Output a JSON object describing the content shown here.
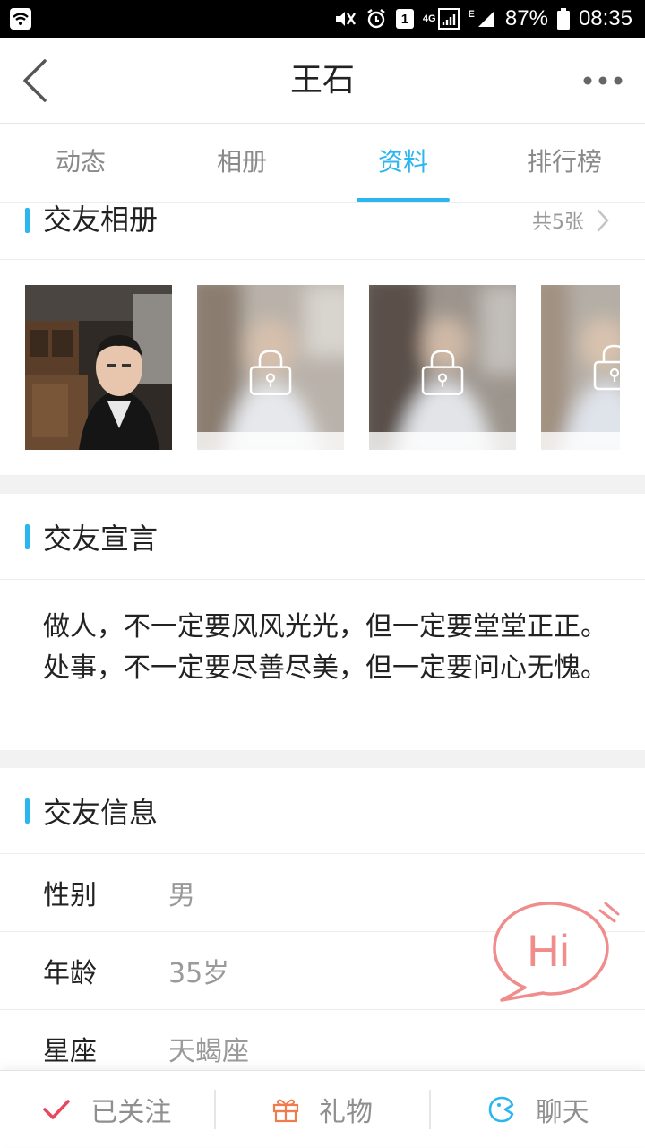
{
  "status_bar": {
    "sim_badge": "1",
    "network_4g": "4G",
    "network_e": "E",
    "battery": "87%",
    "time": "08:35"
  },
  "header": {
    "title": "王石"
  },
  "tabs": [
    {
      "label": "动态"
    },
    {
      "label": "相册"
    },
    {
      "label": "资料",
      "active": true
    },
    {
      "label": "排行榜"
    }
  ],
  "album": {
    "title": "交友相册",
    "count": "共5张"
  },
  "manifesto": {
    "title": "交友宣言",
    "text": "做人，不一定要风风光光，但一定要堂堂正正。处事，不一定要尽善尽美，但一定要问心无愧。"
  },
  "info": {
    "title": "交友信息",
    "rows": [
      {
        "label": "性别",
        "value": "男"
      },
      {
        "label": "年龄",
        "value": "35岁"
      },
      {
        "label": "星座",
        "value": "天蝎座"
      }
    ]
  },
  "hi_bubble": {
    "text": "Hi"
  },
  "bottom_bar": {
    "follow_label": "已关注",
    "gift_label": "礼物",
    "chat_label": "聊天"
  },
  "colors": {
    "accent": "#2cb6ef",
    "follow_check": "#e8475f",
    "gift": "#f07b4f",
    "hi": "#f08c8c"
  }
}
